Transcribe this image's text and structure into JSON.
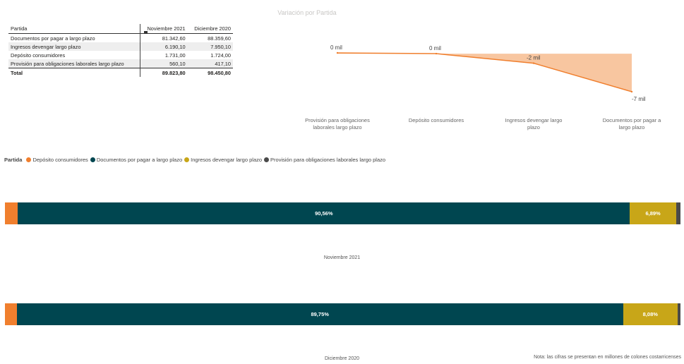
{
  "table": {
    "headers": [
      "Partida",
      "Noviembre 2021",
      "Diciembre 2020"
    ],
    "rows": [
      [
        "Documentos por pagar a largo plazo",
        "81.342,60",
        "88.359,60"
      ],
      [
        "Ingresos devengar largo plazo",
        "6.190,10",
        "7.950,10"
      ],
      [
        "Depósito consumidores",
        "1.731,00",
        "1.724,00"
      ],
      [
        "Provisión para obligaciones laborales largo plazo",
        "560,10",
        "417,10"
      ]
    ],
    "total": [
      "Total",
      "89.823,80",
      "98.450,80"
    ]
  },
  "chart_data": [
    {
      "type": "area",
      "title": "Variación por Partida",
      "categories": [
        "Provisión para obligaciones laborales largo plazo",
        "Depósito consumidores",
        "Ingresos devengar largo plazo",
        "Documentos por pagar a largo plazo"
      ],
      "category_labels": [
        [
          "Provisión para obligaciones",
          "laborales largo plazo"
        ],
        [
          "Depósito consumidores"
        ],
        [
          "Ingresos devengar largo",
          "plazo"
        ],
        [
          "Documentos por pagar a",
          "largo plazo"
        ]
      ],
      "values": [
        143,
        7,
        -1760,
        -7017
      ],
      "data_labels": [
        "0 mil",
        "0 mil",
        "-2 mil",
        "-7 mil"
      ],
      "ylim": [
        -7017,
        143
      ],
      "colors": {
        "fill": "#f8c6a0",
        "line": "#f07f2e"
      }
    },
    {
      "type": "bar",
      "stacked": true,
      "percent": true,
      "legend_title": "Partida",
      "series": [
        {
          "name": "Depósito consumidores",
          "color": "#f07f2e",
          "values": [
            1.93,
            1.75
          ],
          "labels": [
            "",
            ""
          ]
        },
        {
          "name": "Documentos por pagar a largo plazo",
          "color": "#004650",
          "values": [
            90.56,
            89.75
          ],
          "labels": [
            "90,56%",
            "89,75%"
          ]
        },
        {
          "name": "Ingresos devengar largo plazo",
          "color": "#c8a618",
          "values": [
            6.89,
            8.08
          ],
          "labels": [
            "6,89%",
            "8,08%"
          ]
        },
        {
          "name": "Provisión para obligaciones laborales largo plazo",
          "color": "#4a4a4a",
          "values": [
            0.62,
            0.42
          ],
          "labels": [
            "",
            ""
          ]
        }
      ],
      "categories": [
        "Noviembre 2021",
        "Diciembre 2020"
      ]
    }
  ],
  "note": "Nota: las cifras se presentan en millones de colones costarricenses"
}
